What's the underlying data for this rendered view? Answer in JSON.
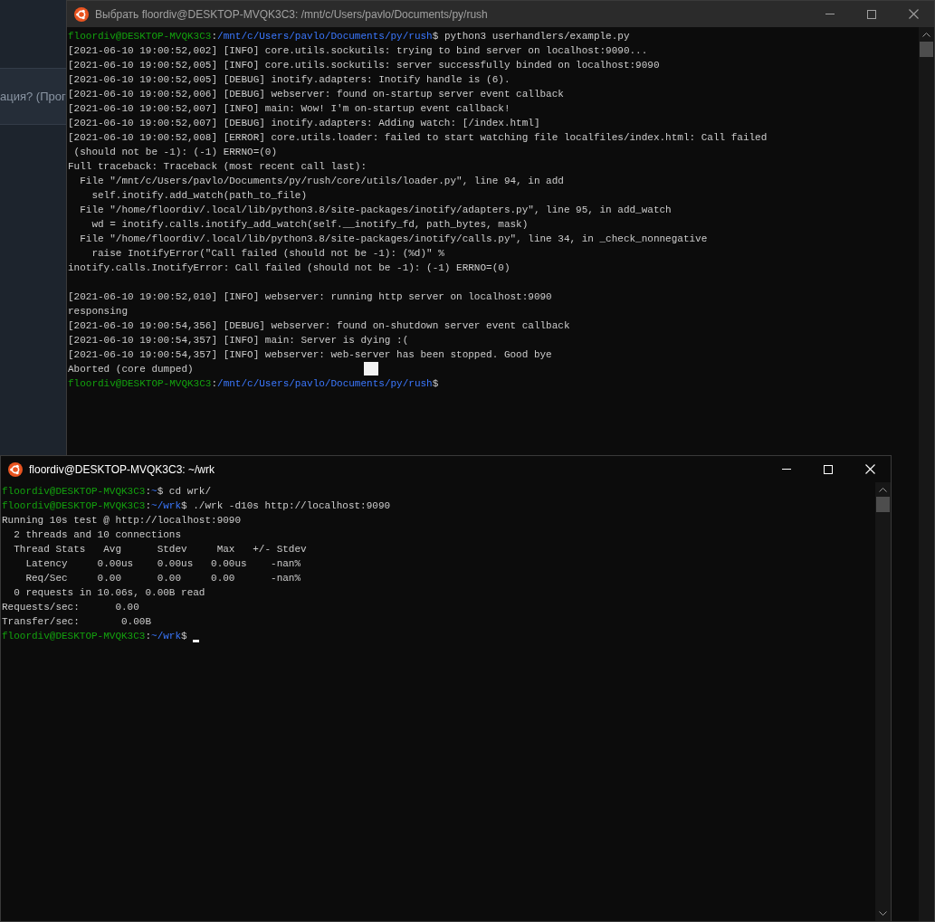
{
  "background_app": {
    "text": "ация? (Прог"
  },
  "windows": [
    {
      "title": "Выбрать floordiv@DESKTOP-MVQK3C3: /mnt/c/Users/pavlo/Documents/py/rush",
      "active": false,
      "lines": [
        {
          "segments": [
            {
              "kind": "user",
              "text": "floordiv@DESKTOP-MVQK3C3"
            },
            {
              "kind": "plain",
              "text": ":"
            },
            {
              "kind": "path",
              "text": "/mnt/c/Users/pavlo/Documents/py/rush"
            },
            {
              "kind": "plain",
              "text": "$ python3 userhandlers/example.py"
            }
          ]
        },
        {
          "segments": [
            {
              "kind": "plain",
              "text": "[2021-06-10 19:00:52,002] [INFO] core.utils.sockutils: trying to bind server on localhost:9090..."
            }
          ]
        },
        {
          "segments": [
            {
              "kind": "plain",
              "text": "[2021-06-10 19:00:52,005] [INFO] core.utils.sockutils: server successfully binded on localhost:9090"
            }
          ]
        },
        {
          "segments": [
            {
              "kind": "plain",
              "text": "[2021-06-10 19:00:52,005] [DEBUG] inotify.adapters: Inotify handle is (6)."
            }
          ]
        },
        {
          "segments": [
            {
              "kind": "plain",
              "text": "[2021-06-10 19:00:52,006] [DEBUG] webserver: found on-startup server event callback"
            }
          ]
        },
        {
          "segments": [
            {
              "kind": "plain",
              "text": "[2021-06-10 19:00:52,007] [INFO] main: Wow! I'm on-startup event callback!"
            }
          ]
        },
        {
          "segments": [
            {
              "kind": "plain",
              "text": "[2021-06-10 19:00:52,007] [DEBUG] inotify.adapters: Adding watch: [/index.html]"
            }
          ]
        },
        {
          "segments": [
            {
              "kind": "plain",
              "text": "[2021-06-10 19:00:52,008] [ERROR] core.utils.loader: failed to start watching file localfiles/index.html: Call failed"
            }
          ]
        },
        {
          "segments": [
            {
              "kind": "plain",
              "text": " (should not be -1): (-1) ERRNO=(0)"
            }
          ]
        },
        {
          "segments": [
            {
              "kind": "plain",
              "text": "Full traceback: Traceback (most recent call last):"
            }
          ]
        },
        {
          "segments": [
            {
              "kind": "plain",
              "text": "  File \"/mnt/c/Users/pavlo/Documents/py/rush/core/utils/loader.py\", line 94, in add"
            }
          ]
        },
        {
          "segments": [
            {
              "kind": "plain",
              "text": "    self.inotify.add_watch(path_to_file)"
            }
          ]
        },
        {
          "segments": [
            {
              "kind": "plain",
              "text": "  File \"/home/floordiv/.local/lib/python3.8/site-packages/inotify/adapters.py\", line 95, in add_watch"
            }
          ]
        },
        {
          "segments": [
            {
              "kind": "plain",
              "text": "    wd = inotify.calls.inotify_add_watch(self.__inotify_fd, path_bytes, mask)"
            }
          ]
        },
        {
          "segments": [
            {
              "kind": "plain",
              "text": "  File \"/home/floordiv/.local/lib/python3.8/site-packages/inotify/calls.py\", line 34, in _check_nonnegative"
            }
          ]
        },
        {
          "segments": [
            {
              "kind": "plain",
              "text": "    raise InotifyError(\"Call failed (should not be -1): (%d)\" %"
            }
          ]
        },
        {
          "segments": [
            {
              "kind": "plain",
              "text": "inotify.calls.InotifyError: Call failed (should not be -1): (-1) ERRNO=(0)"
            }
          ]
        },
        {
          "kind": "blank"
        },
        {
          "segments": [
            {
              "kind": "plain",
              "text": "[2021-06-10 19:00:52,010] [INFO] webserver: running http server on localhost:9090"
            }
          ]
        },
        {
          "segments": [
            {
              "kind": "plain",
              "text": "responsing"
            }
          ]
        },
        {
          "segments": [
            {
              "kind": "plain",
              "text": "[2021-06-10 19:00:54,356] [DEBUG] webserver: found on-shutdown server event callback"
            }
          ]
        },
        {
          "segments": [
            {
              "kind": "plain",
              "text": "[2021-06-10 19:00:54,357] [INFO] main: Server is dying :("
            }
          ]
        },
        {
          "segments": [
            {
              "kind": "plain",
              "text": "[2021-06-10 19:00:54,357] [INFO] webserver: web-server has been stopped. Good bye"
            }
          ]
        },
        {
          "segments": [
            {
              "kind": "plain",
              "text": "Aborted (core dumped)"
            }
          ],
          "block_cursor": true
        },
        {
          "segments": [
            {
              "kind": "user",
              "text": "floordiv@DESKTOP-MVQK3C3"
            },
            {
              "kind": "plain",
              "text": ":"
            },
            {
              "kind": "path",
              "text": "/mnt/c/Users/pavlo/Documents/py/rush"
            },
            {
              "kind": "plain",
              "text": "$"
            }
          ]
        }
      ]
    },
    {
      "title": "floordiv@DESKTOP-MVQK3C3: ~/wrk",
      "active": true,
      "lines": [
        {
          "segments": [
            {
              "kind": "user",
              "text": "floordiv@DESKTOP-MVQK3C3"
            },
            {
              "kind": "plain",
              "text": ":"
            },
            {
              "kind": "path",
              "text": "~"
            },
            {
              "kind": "plain",
              "text": "$ cd wrk/"
            }
          ]
        },
        {
          "segments": [
            {
              "kind": "user",
              "text": "floordiv@DESKTOP-MVQK3C3"
            },
            {
              "kind": "plain",
              "text": ":"
            },
            {
              "kind": "path",
              "text": "~/wrk"
            },
            {
              "kind": "plain",
              "text": "$ ./wrk -d10s http://localhost:9090"
            }
          ]
        },
        {
          "segments": [
            {
              "kind": "plain",
              "text": "Running 10s test @ http://localhost:9090"
            }
          ]
        },
        {
          "segments": [
            {
              "kind": "plain",
              "text": "  2 threads and 10 connections"
            }
          ]
        },
        {
          "segments": [
            {
              "kind": "plain",
              "text": "  Thread Stats   Avg      Stdev     Max   +/- Stdev"
            }
          ]
        },
        {
          "segments": [
            {
              "kind": "plain",
              "text": "    Latency     0.00us    0.00us   0.00us    -nan%"
            }
          ]
        },
        {
          "segments": [
            {
              "kind": "plain",
              "text": "    Req/Sec     0.00      0.00     0.00      -nan%"
            }
          ]
        },
        {
          "segments": [
            {
              "kind": "plain",
              "text": "  0 requests in 10.06s, 0.00B read"
            }
          ]
        },
        {
          "segments": [
            {
              "kind": "plain",
              "text": "Requests/sec:      0.00"
            }
          ]
        },
        {
          "segments": [
            {
              "kind": "plain",
              "text": "Transfer/sec:       0.00B"
            }
          ]
        },
        {
          "segments": [
            {
              "kind": "user",
              "text": "floordiv@DESKTOP-MVQK3C3"
            },
            {
              "kind": "plain",
              "text": ":"
            },
            {
              "kind": "path",
              "text": "~/wrk"
            },
            {
              "kind": "plain",
              "text": "$ "
            }
          ],
          "text_cursor": true
        }
      ]
    }
  ]
}
